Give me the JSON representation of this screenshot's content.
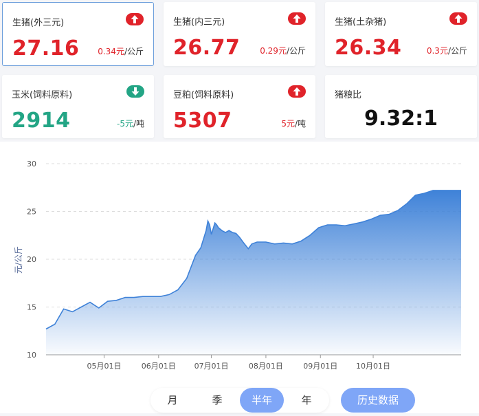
{
  "cards": [
    {
      "name": "生猪(外三元)",
      "value": "27.16",
      "change": "0.34元",
      "unit": "/公斤",
      "trend": "up"
    },
    {
      "name": "生猪(内三元)",
      "value": "26.77",
      "change": "0.29元",
      "unit": "/公斤",
      "trend": "up"
    },
    {
      "name": "生猪(土杂猪)",
      "value": "26.34",
      "change": "0.3元",
      "unit": "/公斤",
      "trend": "up"
    },
    {
      "name": "玉米(饲料原料)",
      "value": "2914",
      "change": "-5元",
      "unit": "/吨",
      "trend": "down"
    },
    {
      "name": "豆粕(饲料原料)",
      "value": "5307",
      "change": "5元",
      "unit": "/吨",
      "trend": "up"
    },
    {
      "name": "猪粮比",
      "value": "9.32:1"
    }
  ],
  "colors": {
    "up": "#e0232a",
    "down": "#23a585",
    "accent": "#7fa6f7",
    "line": "#3f82d8"
  },
  "range_tabs": [
    "月",
    "季",
    "半年",
    "年"
  ],
  "active_tab": "半年",
  "history_button": "历史数据",
  "chart_data": {
    "type": "area",
    "ylabel": "元/公斤",
    "ylim": [
      10,
      30
    ],
    "yticks": [
      10,
      15,
      20,
      25,
      30
    ],
    "xticks": [
      "05月01日",
      "06月01日",
      "07月01日",
      "08月01日",
      "09月01日",
      "10月01日"
    ],
    "grid": "horizontal dashed",
    "x": [
      0,
      5,
      10,
      15,
      20,
      25,
      30,
      35,
      40,
      45,
      50,
      55,
      60,
      65,
      70,
      75,
      80,
      85,
      88,
      91,
      92,
      93,
      94,
      96,
      97,
      98,
      100,
      102,
      104,
      106,
      108,
      110,
      112,
      115,
      117,
      120,
      125,
      130,
      135,
      140,
      145,
      150,
      155,
      160,
      165,
      170,
      175,
      180,
      185,
      190,
      195,
      200,
      205,
      210,
      215,
      220,
      224,
      228,
      231,
      234,
      236
    ],
    "values": [
      12.7,
      13.2,
      14.8,
      14.5,
      15.0,
      15.5,
      14.9,
      15.6,
      15.7,
      16.0,
      16.0,
      16.1,
      16.1,
      16.1,
      16.3,
      16.8,
      18.0,
      20.4,
      21.2,
      23.0,
      24.0,
      23.6,
      22.6,
      23.8,
      23.6,
      23.3,
      23.0,
      22.8,
      23.0,
      22.8,
      22.7,
      22.3,
      21.8,
      21.1,
      21.6,
      21.8,
      21.8,
      21.6,
      21.7,
      21.6,
      21.9,
      22.5,
      23.3,
      23.6,
      23.6,
      23.5,
      23.7,
      23.9,
      24.2,
      24.6,
      24.7,
      25.1,
      25.8,
      26.7,
      26.9,
      27.2,
      27.2,
      27.2,
      27.2,
      27.2,
      27.2
    ]
  }
}
